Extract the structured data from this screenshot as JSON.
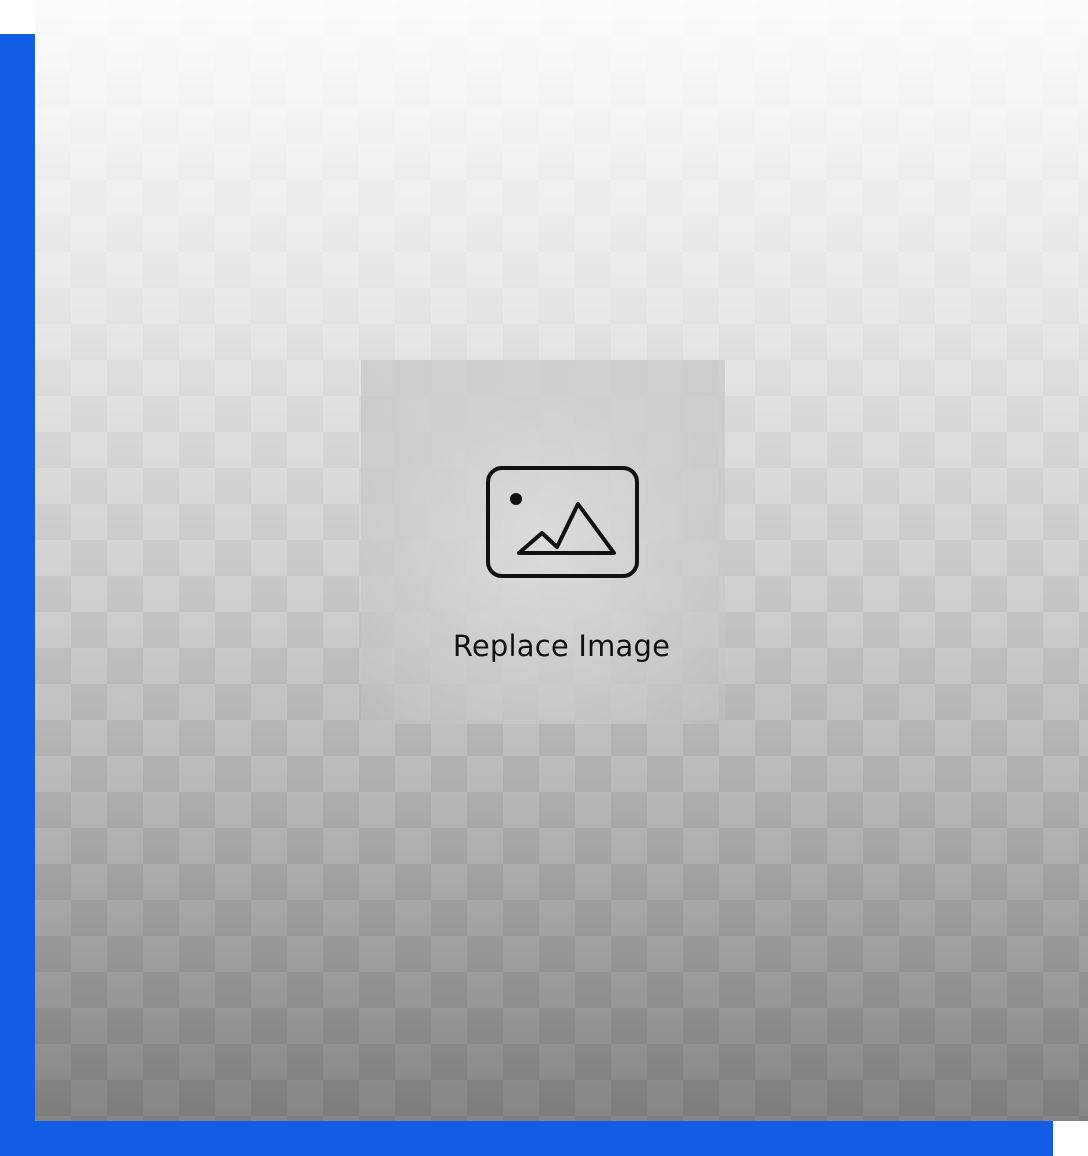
{
  "placeholder": {
    "label": "Replace Image",
    "icon": "image-icon"
  },
  "colors": {
    "accent": "#125ce6",
    "label": "#111111"
  }
}
